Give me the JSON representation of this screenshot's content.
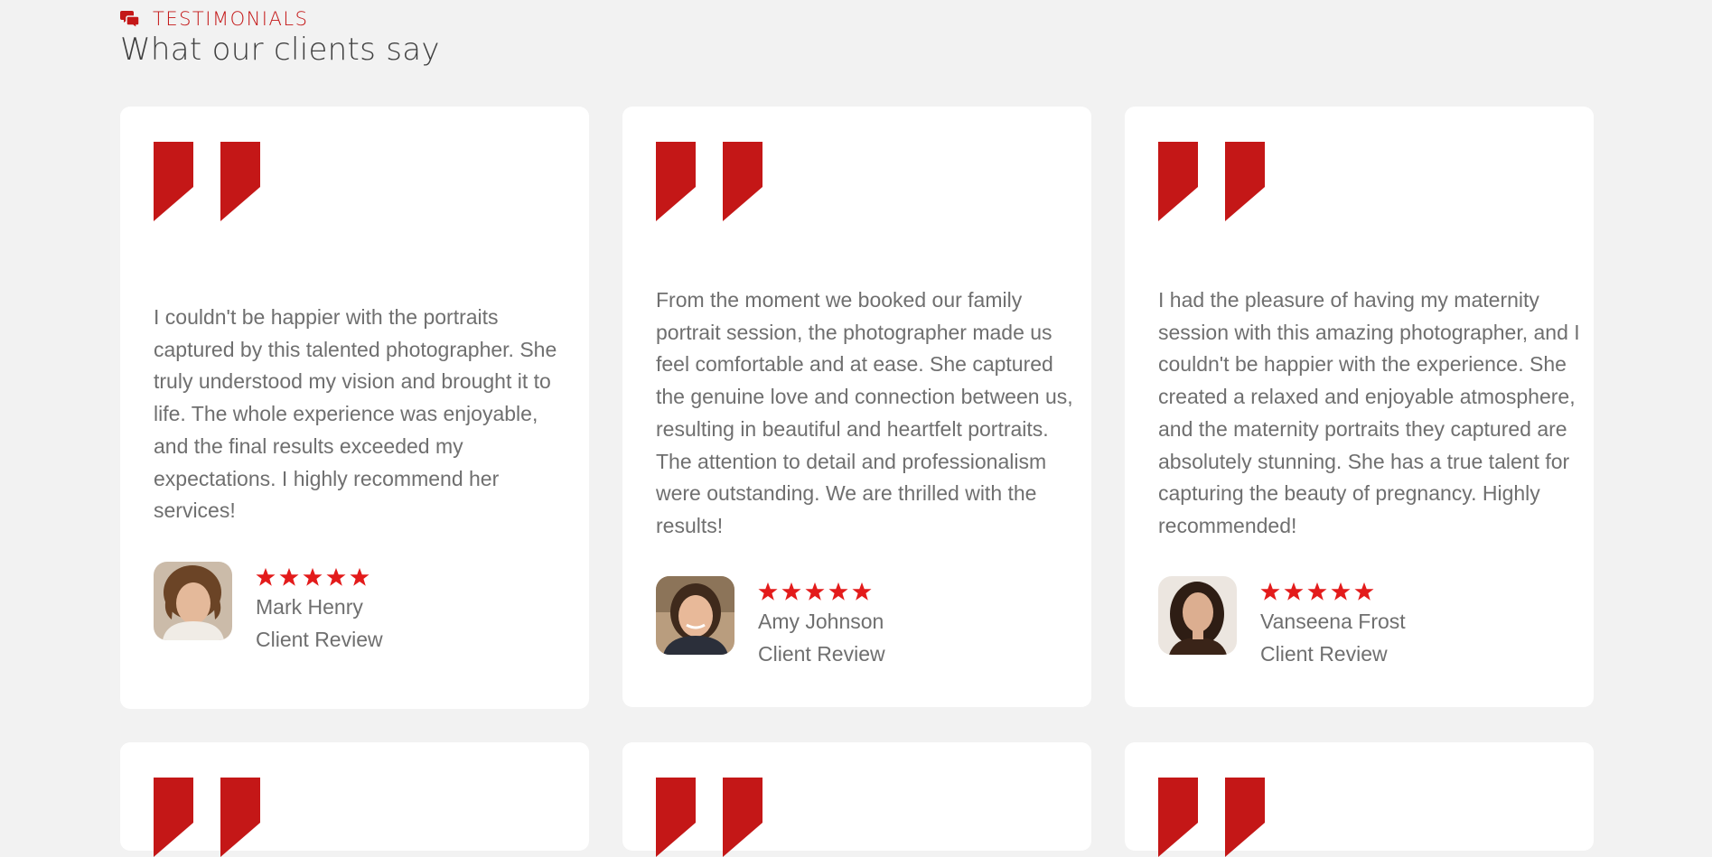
{
  "section": {
    "eyebrow": "TESTIMONIALS",
    "title": "What our clients say",
    "icon": "chat-bubbles-icon",
    "accent_color": "#c41717"
  },
  "testimonials": [
    {
      "text": "I couldn't be happier with the portraits captured by this talented photographer. She truly understood my vision and brought it to life. The whole experience was enjoyable, and the final results exceeded my expectations. I highly recommend her services!",
      "name": "Mark Henry",
      "role": "Client Review",
      "rating": 5
    },
    {
      "text": "From the moment we booked our family portrait session, the photographer made us feel comfortable and at ease. She captured the genuine love and connection between us, resulting in beautiful and heartfelt portraits. The attention to detail and professionalism were outstanding. We are thrilled with the results!",
      "name": "Amy Johnson",
      "role": "Client Review",
      "rating": 5
    },
    {
      "text": "I had the pleasure of having my maternity session with this amazing photographer, and I couldn't be happier with the experience. She created a relaxed and enjoyable atmosphere, and the maternity portraits they captured are absolutely stunning. She has a true talent for capturing the beauty of pregnancy. Highly recommended!",
      "name": "Vanseena Frost",
      "role": "Client Review",
      "rating": 5
    }
  ],
  "star_color": "#e31b1b"
}
